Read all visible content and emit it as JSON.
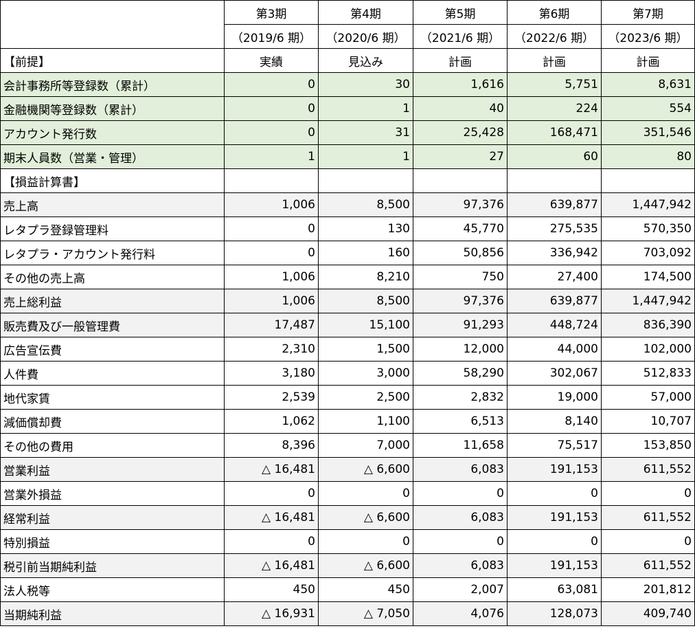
{
  "header": {
    "periods": [
      "第3期",
      "第4期",
      "第5期",
      "第6期",
      "第7期"
    ],
    "fiscal": [
      "（2019/6 期）",
      "（2020/6 期）",
      "（2021/6 期）",
      "（2022/6 期）",
      "（2023/6 期）"
    ]
  },
  "premise": {
    "title": "【前提】",
    "types": [
      "実績",
      "見込み",
      "計画",
      "計画",
      "計画"
    ]
  },
  "kpi_rows": [
    {
      "label": "会計事務所等登録数（累計）",
      "values": [
        "0",
        "30",
        "1,616",
        "5,751",
        "8,631"
      ]
    },
    {
      "label": "金融機関等登録数（累計）",
      "values": [
        "0",
        "1",
        "40",
        "224",
        "554"
      ]
    },
    {
      "label": "アカウント発行数",
      "values": [
        "0",
        "31",
        "25,428",
        "168,471",
        "351,546"
      ]
    },
    {
      "label": "期末人員数（営業・管理）",
      "values": [
        "1",
        "1",
        "27",
        "60",
        "80"
      ]
    }
  ],
  "pl_title": "【損益計算書】",
  "pl_rows": [
    {
      "label": "売上高",
      "values": [
        "1,006",
        "8,500",
        "97,376",
        "639,877",
        "1,447,942"
      ]
    },
    {
      "label": "レタプラ登録管理料",
      "values": [
        "0",
        "130",
        "45,770",
        "275,535",
        "570,350"
      ]
    },
    {
      "label": "レタプラ・アカウント発行料",
      "values": [
        "0",
        "160",
        "50,856",
        "336,942",
        "703,092"
      ]
    },
    {
      "label": "その他の売上高",
      "values": [
        "1,006",
        "8,210",
        "750",
        "27,400",
        "174,500"
      ]
    },
    {
      "label": "売上総利益",
      "values": [
        "1,006",
        "8,500",
        "97,376",
        "639,877",
        "1,447,942"
      ]
    },
    {
      "label": "販売費及び一般管理費",
      "values": [
        "17,487",
        "15,100",
        "91,293",
        "448,724",
        "836,390"
      ]
    },
    {
      "label": "広告宣伝費",
      "values": [
        "2,310",
        "1,500",
        "12,000",
        "44,000",
        "102,000"
      ]
    },
    {
      "label": "人件費",
      "values": [
        "3,180",
        "3,000",
        "58,290",
        "302,067",
        "512,833"
      ]
    },
    {
      "label": "地代家賃",
      "values": [
        "2,539",
        "2,500",
        "2,832",
        "19,000",
        "57,000"
      ]
    },
    {
      "label": "減価償却費",
      "values": [
        "1,062",
        "1,100",
        "6,513",
        "8,140",
        "10,707"
      ]
    },
    {
      "label": "その他の費用",
      "values": [
        "8,396",
        "7,000",
        "11,658",
        "75,517",
        "153,850"
      ]
    },
    {
      "label": "営業利益",
      "values": [
        "△ 16,481",
        "△ 6,600",
        "6,083",
        "191,153",
        "611,552"
      ]
    },
    {
      "label": "営業外損益",
      "values": [
        "0",
        "0",
        "0",
        "0",
        "0"
      ]
    },
    {
      "label": "経常利益",
      "values": [
        "△ 16,481",
        "△ 6,600",
        "6,083",
        "191,153",
        "611,552"
      ]
    },
    {
      "label": "特別損益",
      "values": [
        "0",
        "0",
        "0",
        "0",
        "0"
      ]
    },
    {
      "label": "税引前当期純利益",
      "values": [
        "△ 16,481",
        "△ 6,600",
        "6,083",
        "191,153",
        "611,552"
      ]
    },
    {
      "label": "法人税等",
      "values": [
        "450",
        "450",
        "2,007",
        "63,081",
        "201,812"
      ]
    },
    {
      "label": "当期純利益",
      "values": [
        "△ 16,931",
        "△ 7,050",
        "4,076",
        "128,073",
        "409,740"
      ]
    }
  ],
  "colors": {
    "kpi_fill": "#e2efda",
    "total_fill": "#f2f2f2",
    "border": "#000000"
  }
}
